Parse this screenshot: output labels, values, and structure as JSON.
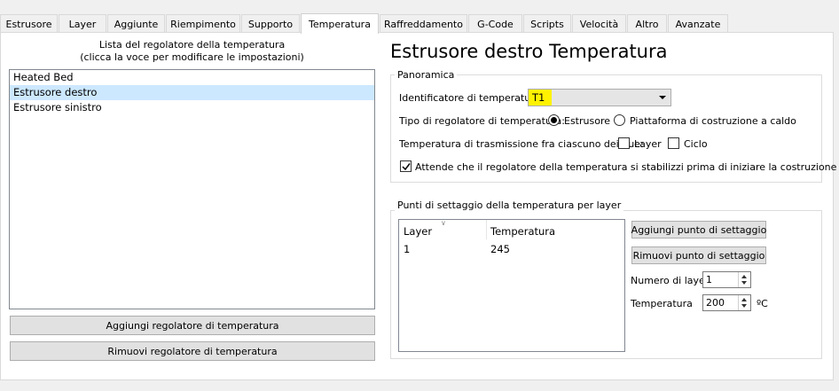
{
  "tabs": [
    {
      "label": "Estrusore"
    },
    {
      "label": "Layer"
    },
    {
      "label": "Aggiunte"
    },
    {
      "label": "Riempimento"
    },
    {
      "label": "Supporto"
    },
    {
      "label": "Temperatura"
    },
    {
      "label": "Raffreddamento"
    },
    {
      "label": "G-Code"
    },
    {
      "label": "Scripts"
    },
    {
      "label": "Velocità"
    },
    {
      "label": "Altro"
    },
    {
      "label": "Avanzate"
    }
  ],
  "active_tab": "Temperatura",
  "left": {
    "caption_line1": "Lista del regolatore della temperatura",
    "caption_line2": "(clicca la voce per modificare le impostazioni)",
    "items": [
      {
        "label": "Heated Bed"
      },
      {
        "label": "Estrusore destro"
      },
      {
        "label": "Estrusore sinistro"
      }
    ],
    "selected_item": "Estrusore destro",
    "add_button": "Aggiungi regolatore di temperatura",
    "remove_button": "Rimuovi regolatore di temperatura"
  },
  "right": {
    "title": "Estrusore destro Temperatura",
    "overview": {
      "group_title": "Panoramica",
      "identifier_label": "Identificatore di temperatura",
      "identifier_value": "T1",
      "type_label": "Tipo di regolatore di temperatura:",
      "type_option_extruder": "Estrusore",
      "type_option_bed": "Piattaforma di costruzione a caldo",
      "type_selected": "Estrusore",
      "transition_label": "Temperatura di trasmissione fra ciascuno dei due:",
      "transition_layer": "Layer",
      "transition_cycle": "Ciclo",
      "transition_layer_checked": false,
      "transition_cycle_checked": false,
      "wait_label": "Attende che il regolatore della temperatura si stabilizzi prima di iniziare la costruzione",
      "wait_checked": true
    },
    "setpoints": {
      "group_title": "Punti di settaggio della temperatura per layer",
      "columns": [
        "Layer",
        "Temperatura"
      ],
      "rows": [
        {
          "layer": "1",
          "temperature": "245"
        }
      ],
      "add_button": "Aggiungi punto di settaggio",
      "remove_button": "Rimuovi punto di settaggio",
      "layer_number_label": "Numero di layer",
      "layer_number_value": "1",
      "temperature_label": "Temperatura",
      "temperature_value": "200",
      "temperature_unit": "ºC"
    }
  },
  "colors": {
    "selection": "#cce8ff",
    "highlight": "#fff200"
  }
}
